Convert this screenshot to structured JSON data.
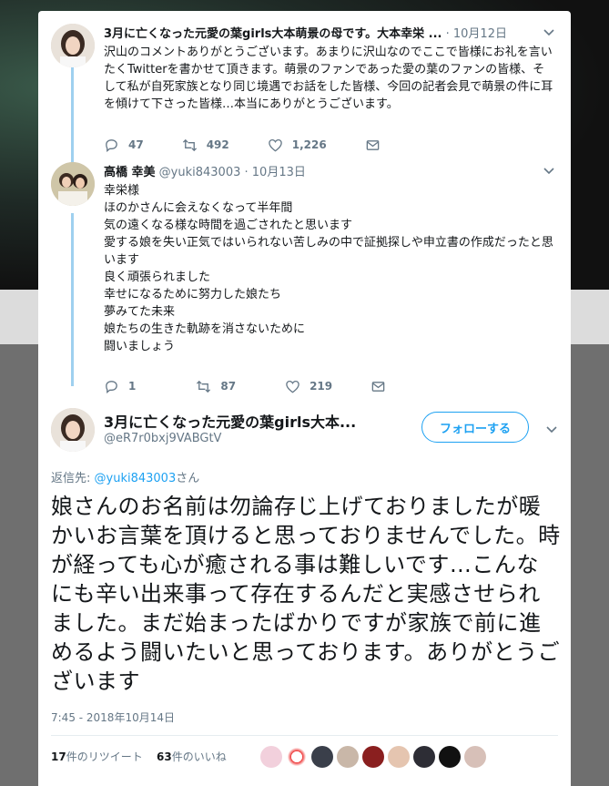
{
  "tweet1": {
    "name": "3月に亡くなった元愛の葉girls大本萌景の母です。大本幸栄 ...",
    "date": "10月12日",
    "text": "沢山のコメントありがとうございます。あまりに沢山なのでここで皆様にお礼を言いたくTwitterを書かせて頂きます。萌景のファンであった愛の葉のファンの皆様、そして私が自死家族となり同じ境遇でお話をした皆様、今回の記者会見で萌景の件に耳を傾けて下さった皆様…本当にありがとうございます。",
    "replies": "47",
    "retweets": "492",
    "likes": "1,226"
  },
  "tweet2": {
    "name": "高橋 幸美",
    "handle": "@yuki843003",
    "date": "10月13日",
    "lines": [
      "幸栄様",
      "ほのかさんに会えなくなって半年間",
      "気の遠くなる様な時間を過ごされたと思います",
      "愛する娘を失い正気ではいられない苦しみの中で証拠探しや申立書の作成だったと思います",
      "良く頑張られました",
      "幸せになるために努力した娘たち",
      "夢みてた未来",
      "娘たちの生きた軌跡を消さないために",
      "闘いましょう"
    ],
    "replies": "1",
    "retweets": "87",
    "likes": "219"
  },
  "main": {
    "name": "3月に亡くなった元愛の葉girls大本...",
    "handle": "@eR7r0bxj9VABGtV",
    "follow_label": "フォローする",
    "reply_prefix": "返信先: ",
    "reply_mention": "@yuki843003",
    "reply_suffix": "さん",
    "text": "娘さんのお名前は勿論存じ上げておりましたが暖かいお言葉を頂けると思っておりませんでした。時が経っても心が癒される事は難しいです…こんなにも辛い出来事って存在するんだと実感させられました。まだ始まったばかりですが家族で前に進めるよう闘いたいと思っております。ありがとうございます",
    "timestamp": "7:45 - 2018年10月14日",
    "retweet_count": "17",
    "retweet_label": "件のリツイート",
    "like_count": "63",
    "like_label": "件のいいね"
  },
  "colors": {
    "accent": "#1da1f2",
    "thread_line": "#9fd0ef",
    "muted": "#657786"
  },
  "icons": [
    "reply-icon",
    "retweet-icon",
    "like-icon",
    "dm-icon",
    "chevron-down-icon"
  ]
}
